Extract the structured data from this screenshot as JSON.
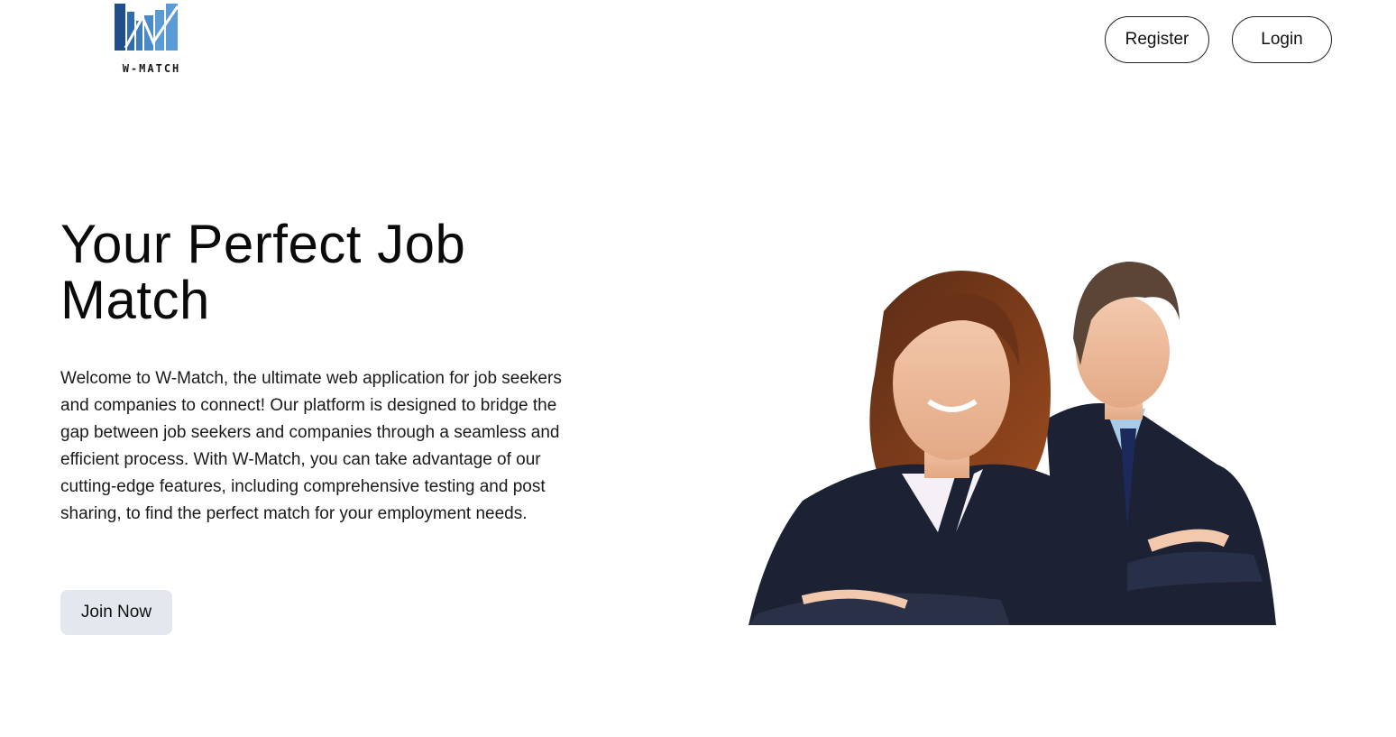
{
  "header": {
    "logo_text": "W-MATCH",
    "logo_icon": "bar-chart-logo-icon",
    "register_label": "Register",
    "login_label": "Login"
  },
  "hero": {
    "title": "Your Perfect Job Match",
    "description": "Welcome to W-Match, the ultimate web application for job seekers and companies to connect! Our platform is designed to bridge the gap between job seekers and companies through a seamless and efficient process. With W-Match, you can take advantage of our cutting-edge features, including comprehensive testing and post sharing, to find the perfect match for your employment needs.",
    "cta_label": "Join Now",
    "image_subject": "two-business-professionals-photo"
  },
  "colors": {
    "logo_dark_blue": "#1f4e8c",
    "logo_light_blue": "#5b9bd5",
    "cta_background": "#e3e8ef",
    "suit_navy": "#1c2233"
  }
}
